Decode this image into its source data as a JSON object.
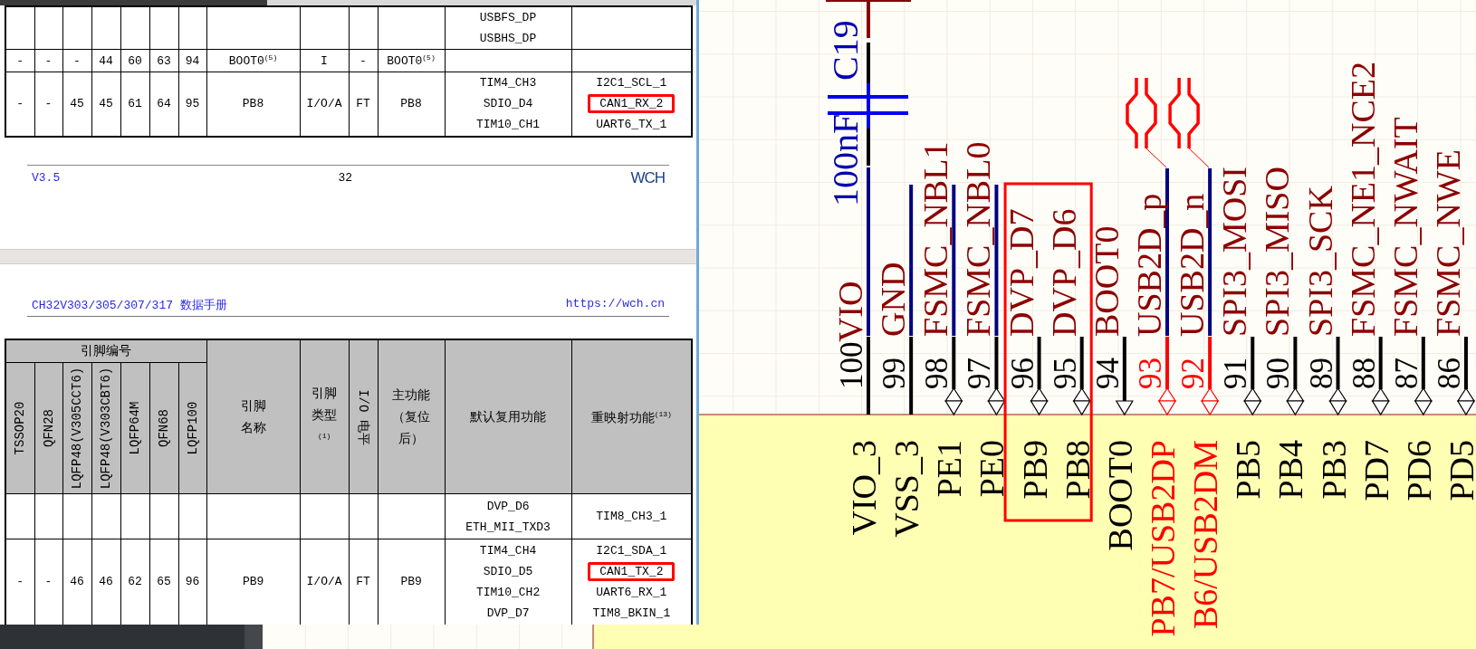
{
  "document_viewer": {
    "page_top": {
      "table": {
        "rows": [
          {
            "default_functions": [
              "USBFS_DP",
              "USBHS_DP"
            ]
          },
          {
            "cells": [
              "-",
              "-",
              "-",
              "44",
              "60",
              "63",
              "94",
              "BOOT0$^{(5)}$",
              "I",
              "-",
              "BOOT0$^{(5)}$"
            ]
          },
          {
            "cells": [
              "-",
              "-",
              "45",
              "45",
              "61",
              "64",
              "95",
              "PB8",
              "I/O/A",
              "FT",
              "PB8"
            ],
            "default_functions": [
              "TIM4_CH3",
              "SDIO_D4",
              "TIM10_CH1"
            ],
            "remap_functions": [
              {
                "text": "I2C1_SCL_1",
                "highlighted": false
              },
              {
                "text": "CAN1_RX_2",
                "highlighted": true
              },
              {
                "text": "UART6_TX_1",
                "highlighted": false
              }
            ]
          }
        ]
      },
      "footer": {
        "version": "V3.5",
        "page": "32",
        "logo": "WCH"
      }
    },
    "page_bottom": {
      "header": {
        "title": "CH32V303/305/307/317 数据手册",
        "url": "https://wch.cn"
      },
      "table": {
        "header": {
          "group": "引脚编号",
          "packages": [
            "TSSOP20",
            "QFN28",
            "LQFP48(V305CCT6)",
            "LQFP48(V303CBT6)",
            "LQFP64M",
            "QFN68",
            "LQFP100"
          ],
          "columns": [
            {
              "kind": "stacked",
              "lines": [
                "引脚",
                "名称"
              ]
            },
            {
              "kind": "stacked",
              "lines": [
                "引脚",
                "类型",
                "$^{(1)}$"
              ]
            },
            {
              "kind": "vertical",
              "label": "I/O 电平"
            },
            {
              "kind": "stacked",
              "lines": [
                "主功能",
                "（复位",
                "后）"
              ]
            },
            {
              "kind": "stacked",
              "lines": [
                "默认复用功能"
              ]
            },
            {
              "kind": "stacked",
              "lines": [
                "重映射功能$^{(13)}$"
              ]
            }
          ]
        },
        "rows": [
          {
            "default_functions": [
              "DVP_D6",
              "ETH_MII_TXD3"
            ],
            "remap_functions": [
              {
                "text": "TIM8_CH3_1",
                "highlighted": false
              }
            ]
          },
          {
            "cells": [
              "-",
              "-",
              "46",
              "46",
              "62",
              "65",
              "96",
              "PB9",
              "I/O/A",
              "FT",
              "PB9"
            ],
            "default_functions": [
              "TIM4_CH4",
              "SDIO_D5",
              "TIM10_CH2",
              "DVP_D7"
            ],
            "remap_functions": [
              {
                "text": "I2C1_SDA_1",
                "highlighted": false
              },
              {
                "text": "CAN1_TX_2",
                "highlighted": true
              },
              {
                "text": "UART6_RX_1",
                "highlighted": false
              },
              {
                "text": "TIM8_BKIN_1",
                "highlighted": false
              }
            ]
          }
        ]
      }
    }
  },
  "schematic": {
    "capacitor": {
      "designator": "C19",
      "value": "100nF"
    },
    "pins": [
      {
        "number": "100",
        "name": "VIO_3",
        "net": "VIO",
        "kind": "power",
        "wired": true,
        "highlighted": false
      },
      {
        "number": "99",
        "name": "VSS_3",
        "net": "GND",
        "kind": "power",
        "wired": true,
        "highlighted": false
      },
      {
        "number": "98",
        "name": "PE1",
        "net": "FSMC_NBL1",
        "kind": "bidir",
        "wired": true,
        "highlighted": false
      },
      {
        "number": "97",
        "name": "PE0",
        "net": "FSMC_NBL0",
        "kind": "bidir",
        "wired": true,
        "highlighted": false
      },
      {
        "number": "96",
        "name": "PB9",
        "net": "DVP_D7",
        "kind": "bidir",
        "wired": false,
        "highlighted": true
      },
      {
        "number": "95",
        "name": "PB8",
        "net": "DVP_D6",
        "kind": "bidir",
        "wired": false,
        "highlighted": true
      },
      {
        "number": "94",
        "name": "BOOT0",
        "net": "BOOT0",
        "kind": "input",
        "wired": false,
        "highlighted": false
      },
      {
        "number": "93",
        "name": "PB7/USB2DP",
        "net": "USB2D_p",
        "kind": "usb",
        "wired": true,
        "highlighted": false
      },
      {
        "number": "92",
        "name": "B6/USB2DM",
        "net": "USB2D_n",
        "kind": "usb",
        "wired": true,
        "highlighted": false
      },
      {
        "number": "91",
        "name": "PB5",
        "net": "SPI3_MOSI",
        "kind": "bidir",
        "wired": false,
        "highlighted": false
      },
      {
        "number": "90",
        "name": "PB4",
        "net": "SPI3_MISO",
        "kind": "bidir",
        "wired": false,
        "highlighted": false
      },
      {
        "number": "89",
        "name": "PB3",
        "net": "SPI3_SCK",
        "kind": "bidir",
        "wired": false,
        "highlighted": false
      },
      {
        "number": "88",
        "name": "PD7",
        "net": "FSMC_NE1_NCE2",
        "kind": "bidir",
        "wired": false,
        "highlighted": false
      },
      {
        "number": "87",
        "name": "PD6",
        "net": "FSMC_NWAIT",
        "kind": "bidir",
        "wired": false,
        "highlighted": false
      },
      {
        "number": "86",
        "name": "PD5",
        "net": "FSMC_NWE",
        "kind": "bidir",
        "wired": false,
        "highlighted": false
      }
    ]
  }
}
